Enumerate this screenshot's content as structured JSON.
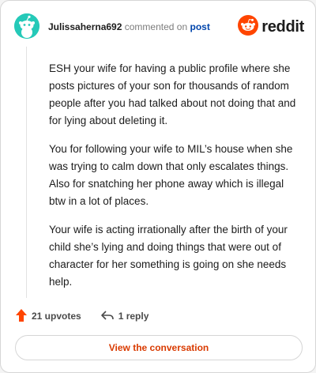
{
  "comment": {
    "author": "Julissaherna692",
    "action_text": "commented on",
    "post_link": "post",
    "paragraphs": [
      "ESH your wife for having a public profile where she posts pictures of your son for thousands of random people after you had talked about not doing that and for lying about deleting it.",
      "You for following your wife to MIL’s house when she was trying to calm down that only escalates things. Also for snatching her phone away which is illegal btw in a lot of places.",
      "Your wife is acting irrationally after the birth of your child she’s lying and doing things that were out of character for her something is going on she needs help."
    ]
  },
  "brand": {
    "name": "reddit",
    "icon": "reddit-logo-icon",
    "color": "#ff4500"
  },
  "avatar": {
    "icon": "snoo-avatar-icon",
    "color": "#25c9b8"
  },
  "stats": {
    "upvotes_label": "21 upvotes",
    "upvote_icon": "upvote-arrow-icon",
    "upvote_color": "#ff4500",
    "replies_label": "1 reply",
    "reply_icon": "reply-arrow-icon"
  },
  "cta": {
    "label": "View the conversation",
    "color": "#d93a00"
  }
}
